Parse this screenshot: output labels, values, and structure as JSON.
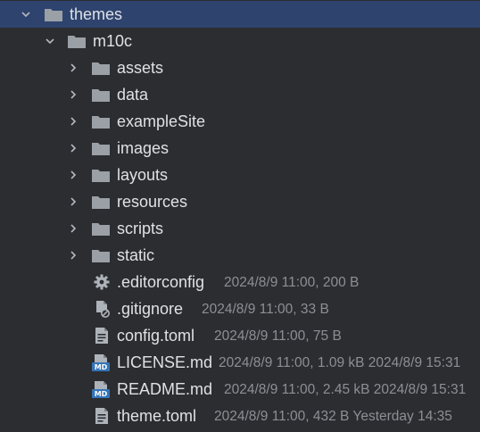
{
  "tree": {
    "root": {
      "label": "themes"
    },
    "theme": {
      "label": "m10c"
    },
    "folders": [
      {
        "label": "assets"
      },
      {
        "label": "data"
      },
      {
        "label": "exampleSite"
      },
      {
        "label": "images"
      },
      {
        "label": "layouts"
      },
      {
        "label": "resources"
      },
      {
        "label": "scripts"
      },
      {
        "label": "static"
      }
    ],
    "files": [
      {
        "label": ".editorconfig",
        "meta": "2024/8/9 11:00, 200 B",
        "icon": "gear-icon"
      },
      {
        "label": ".gitignore",
        "meta": "2024/8/9 11:00, 33 B",
        "icon": "ignore-file-icon"
      },
      {
        "label": "config.toml",
        "meta": "2024/8/9 11:00, 75 B",
        "icon": "text-file-icon"
      },
      {
        "label": "LICENSE.md",
        "meta": "2024/8/9 11:00, 1.09 kB 2024/8/9 15:31",
        "icon": "markdown-file-icon"
      },
      {
        "label": "README.md",
        "meta": "2024/8/9 11:00, 2.45 kB 2024/8/9 15:31",
        "icon": "markdown-file-icon"
      },
      {
        "label": "theme.toml",
        "meta": "2024/8/9 11:00, 432 B Yesterday 14:35",
        "icon": "text-file-icon"
      }
    ]
  },
  "colors": {
    "background": "#2b2d30",
    "selection": "#2e436e",
    "text": "#dfe1e5",
    "meta_text": "#8c8f94",
    "folder_icon": "#9aa0a6",
    "markdown_badge": "#3574b8"
  }
}
